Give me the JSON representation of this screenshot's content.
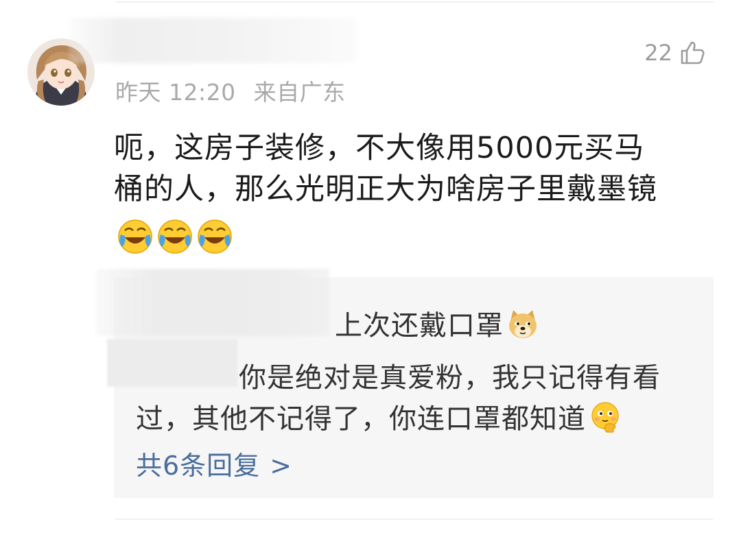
{
  "comment": {
    "timestamp": "昨天 12:20",
    "location": "来自广东",
    "like_count": "22",
    "text_line1": "呃，这房子装修，不大像用5000元买马",
    "text_line2": "桶的人，那么光明正大为啥房子里戴墨镜",
    "emojis": [
      "laugh-cry-emoji",
      "laugh-cry-emoji",
      "laugh-cry-emoji"
    ]
  },
  "replies": {
    "reply1_text": "上次还戴口罩",
    "reply1_emoji": "doge-emoji",
    "reply2_line1": "你是绝对是真爱粉，我只记得有看",
    "reply2_line2": "过，其他不记得了，你连口罩都知道",
    "reply2_emoji": "thinking-emoji",
    "more_label": "共6条回复",
    "more_chevron": ">"
  },
  "colors": {
    "text_primary": "#1b1b1b",
    "meta": "#a9a9a9",
    "link": "#4a6d9c",
    "reply_bg": "#f6f6f6"
  }
}
